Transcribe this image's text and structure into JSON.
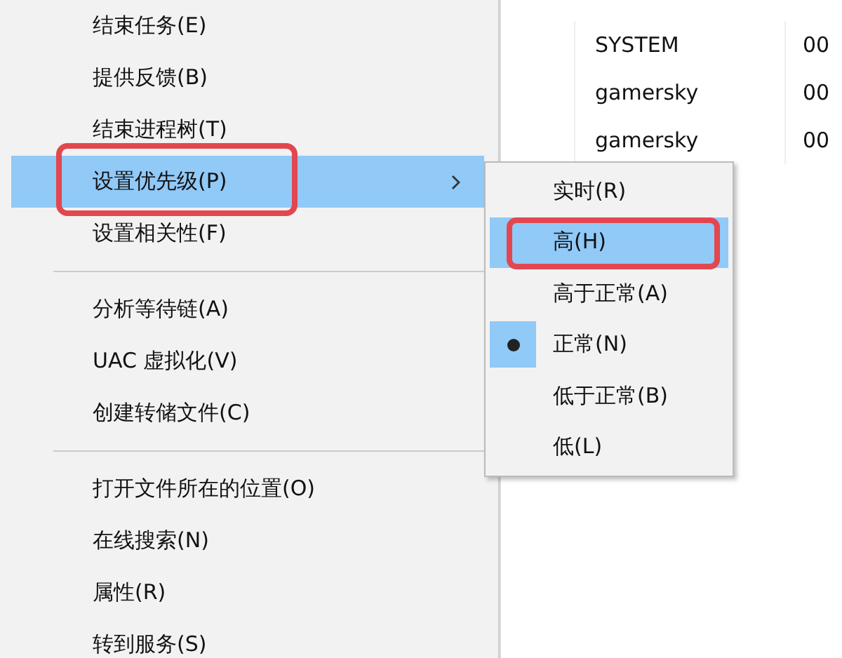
{
  "process_list": {
    "rows": [
      {
        "user": "SYSTEM",
        "column_2": "00"
      },
      {
        "user": "gamersky",
        "column_2": "00"
      },
      {
        "user": "gamersky",
        "column_2": "00"
      }
    ]
  },
  "menu": {
    "items": [
      {
        "kind": "item",
        "label": "结束任务(E)",
        "selected": false,
        "has_submenu": false,
        "annotated": false
      },
      {
        "kind": "item",
        "label": "提供反馈(B)",
        "selected": false,
        "has_submenu": false,
        "annotated": false
      },
      {
        "kind": "item",
        "label": "结束进程树(T)",
        "selected": false,
        "has_submenu": false,
        "annotated": false
      },
      {
        "kind": "item",
        "label": "设置优先级(P)",
        "selected": true,
        "has_submenu": true,
        "annotated": true
      },
      {
        "kind": "item",
        "label": "设置相关性(F)",
        "selected": false,
        "has_submenu": false,
        "annotated": false
      },
      {
        "kind": "separator"
      },
      {
        "kind": "item",
        "label": "分析等待链(A)",
        "selected": false,
        "has_submenu": false,
        "annotated": false
      },
      {
        "kind": "item",
        "label": "UAC 虚拟化(V)",
        "selected": false,
        "has_submenu": false,
        "annotated": false
      },
      {
        "kind": "item",
        "label": "创建转储文件(C)",
        "selected": false,
        "has_submenu": false,
        "annotated": false
      },
      {
        "kind": "separator"
      },
      {
        "kind": "item",
        "label": "打开文件所在的位置(O)",
        "selected": false,
        "has_submenu": false,
        "annotated": false
      },
      {
        "kind": "item",
        "label": "在线搜索(N)",
        "selected": false,
        "has_submenu": false,
        "annotated": false
      },
      {
        "kind": "item",
        "label": "属性(R)",
        "selected": false,
        "has_submenu": false,
        "annotated": false
      },
      {
        "kind": "item",
        "label": "转到服务(S)",
        "selected": false,
        "has_submenu": false,
        "annotated": false
      }
    ]
  },
  "submenu": {
    "items": [
      {
        "label": "实时(R)",
        "selected": false,
        "checked": false,
        "annotated": false
      },
      {
        "label": "高(H)",
        "selected": true,
        "checked": false,
        "annotated": true
      },
      {
        "label": "高于正常(A)",
        "selected": false,
        "checked": false,
        "annotated": false
      },
      {
        "label": "正常(N)",
        "selected": false,
        "checked": true,
        "annotated": false
      },
      {
        "label": "低于正常(B)",
        "selected": false,
        "checked": false,
        "annotated": false
      },
      {
        "label": "低(L)",
        "selected": false,
        "checked": false,
        "annotated": false
      }
    ]
  }
}
